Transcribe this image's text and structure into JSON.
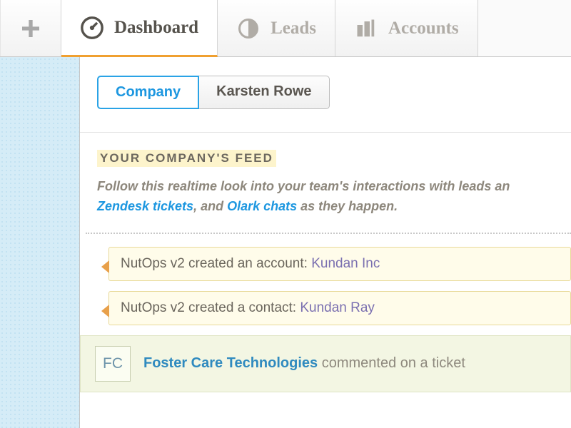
{
  "nav": {
    "tabs": [
      {
        "label": "Dashboard",
        "active": true
      },
      {
        "label": "Leads",
        "active": false
      },
      {
        "label": "Accounts",
        "active": false
      }
    ]
  },
  "subtabs": [
    {
      "label": "Company",
      "active": true
    },
    {
      "label": "Karsten Rowe",
      "active": false
    }
  ],
  "feed": {
    "heading": "YOUR COMPANY'S FEED",
    "desc_pre": "Follow this realtime look into your team's interactions with leads an",
    "desc_link1": "Zendesk tickets",
    "desc_mid": ", and ",
    "desc_link2": "Olark chats",
    "desc_post": " as they happen.",
    "items": [
      {
        "actor": "NutOps v2",
        "verb": " created an account: ",
        "entity": "Kundan Inc"
      },
      {
        "actor": "NutOps v2",
        "verb": " created a contact: ",
        "entity": "Kundan Ray"
      }
    ],
    "comment": {
      "initials": "FC",
      "company": "Foster Care Technologies",
      "text": " commented on a ticket"
    }
  }
}
